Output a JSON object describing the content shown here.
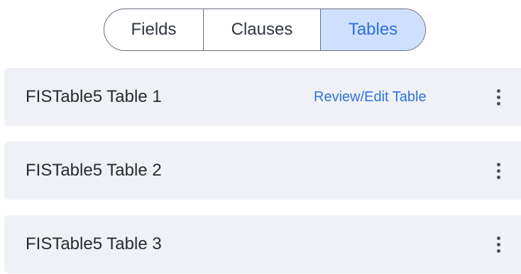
{
  "tabs": {
    "fields": "Fields",
    "clauses": "Clauses",
    "tables": "Tables",
    "active": "Tables"
  },
  "rows": [
    {
      "name": "FISTable5 Table 1",
      "action": "Review/Edit Table"
    },
    {
      "name": "FISTable5 Table 2"
    },
    {
      "name": "FISTable5 Table 3"
    }
  ],
  "colors": {
    "active_tab_bg": "#cfe0ff",
    "active_tab_text": "#2f6fdc",
    "row_bg": "#eff1f7",
    "link": "#2f73d9"
  },
  "icons": {
    "row_menu": "more-vertical-icon"
  }
}
